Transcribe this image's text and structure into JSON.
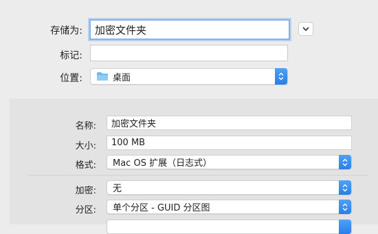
{
  "top": {
    "save_as_label": "存储为:",
    "save_as_value": "加密文件夹",
    "tags_label": "标记:",
    "tags_value": "",
    "location_label": "位置:",
    "location_value": "桌面"
  },
  "details": {
    "name_label": "名称:",
    "name_value": "加密文件夹",
    "size_label": "大小:",
    "size_value": "100 MB",
    "format_label": "格式:",
    "format_value": "Mac OS 扩展（日志式）",
    "encryption_label": "加密:",
    "encryption_value": "无",
    "partition_label": "分区:",
    "partition_value": "单个分区 - GUID 分区图"
  },
  "colors": {
    "accent": "#2b7ee8",
    "folder": "#6cb8ec"
  }
}
